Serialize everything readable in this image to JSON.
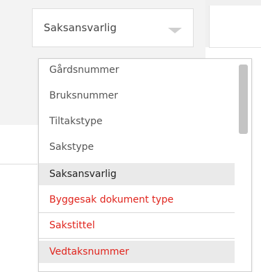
{
  "select": {
    "value": "Saksansvarlig",
    "arrow_icon": "chevron-down-icon"
  },
  "dropdown": {
    "options": [
      {
        "label": "Gårdsnummer",
        "state": "normal"
      },
      {
        "label": "Bruksnummer",
        "state": "normal"
      },
      {
        "label": "Tiltakstype",
        "state": "normal"
      },
      {
        "label": "Sakstype",
        "state": "normal"
      },
      {
        "label": "Saksansvarlig",
        "state": "selected"
      },
      {
        "label": "Byggesak dokument type",
        "state": "error"
      },
      {
        "label": "Sakstittel",
        "state": "error"
      },
      {
        "label": "Vedtaksnummer",
        "state": "error"
      }
    ]
  },
  "colors": {
    "selected_bg": "#eaeaea",
    "error_text": "#e0241d",
    "normal_text": "#555555",
    "panel_bg": "#f3f3f3"
  }
}
